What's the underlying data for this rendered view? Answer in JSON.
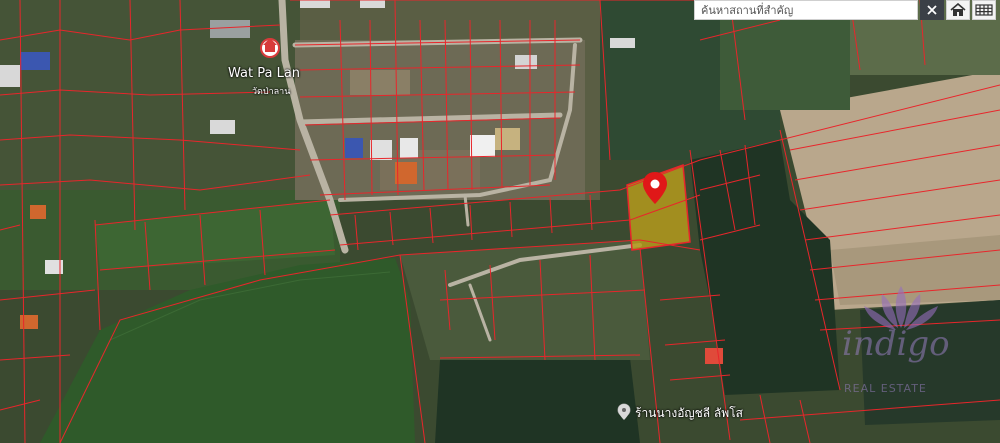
{
  "search": {
    "placeholder": "ค้นหาสถานที่สำคัญ"
  },
  "toolbar": {
    "clear_icon": "close-icon",
    "home_icon": "home-icon",
    "grid_icon": "grid-icon"
  },
  "places": {
    "temple_name": "Wat Pa Lan",
    "temple_name_thai": "วัดป่าลาน",
    "shop_name": "ร้านนางอัญชลี ลัพโส"
  },
  "watermark": {
    "brand": "indigo",
    "tagline": "REAL ESTATE"
  },
  "colors": {
    "parcel_line": "#e8262b",
    "highlight_fill": "#b59a1c",
    "pin": "#e01818",
    "rice_field": "#2f5a2a",
    "pond_water": "#1f3424"
  }
}
